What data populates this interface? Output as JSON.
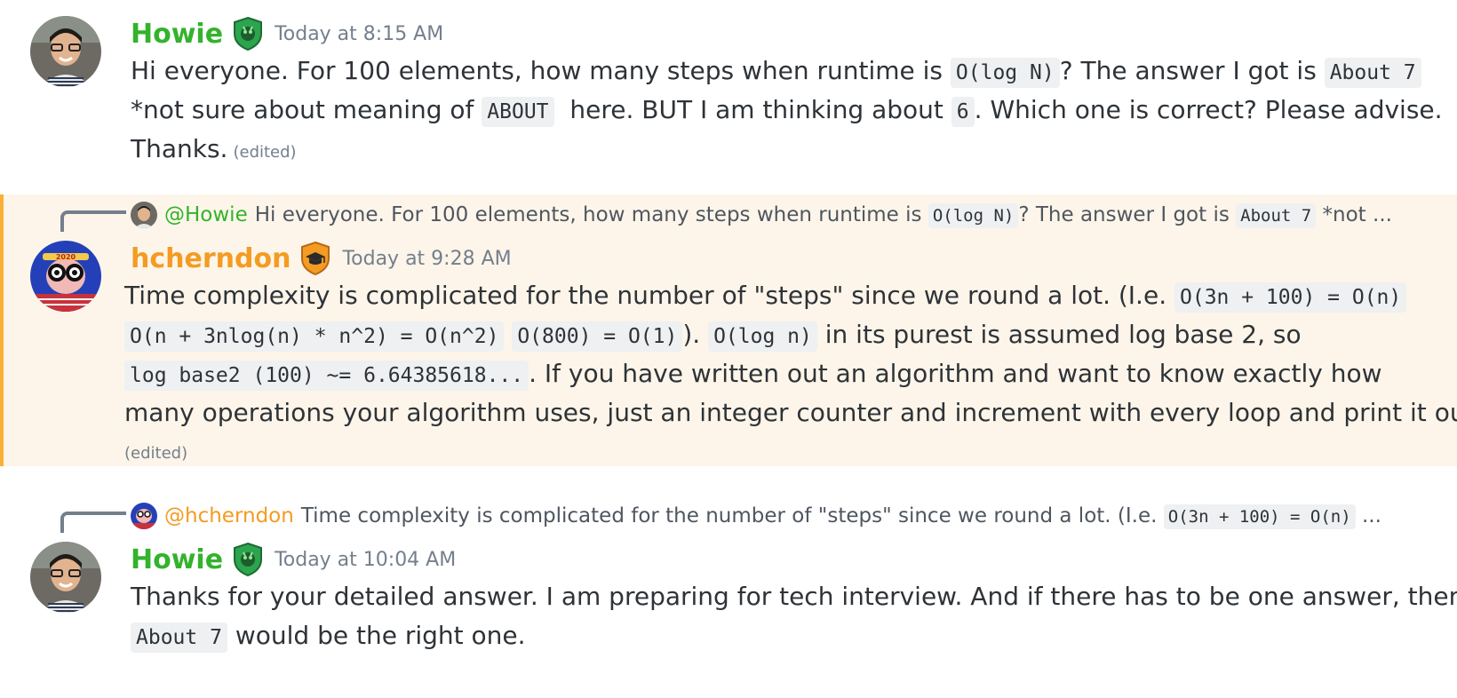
{
  "messages": [
    {
      "author": "Howie",
      "timestamp": "Today at 8:15 AM",
      "line1_a": "Hi everyone. For 100 elements, how many steps when runtime is ",
      "line1_code1": "O(log N)",
      "line1_b": "? The answer I got is ",
      "line1_code2": "About 7",
      "line2_a": "*not sure about meaning of ",
      "line2_code1": "ABOUT",
      "line2_b": "  here. BUT I am thinking about ",
      "line2_code2": "6",
      "line2_c": ". Which one is correct? Please advise.",
      "line3_a": "Thanks.",
      "edited": "(edited)"
    },
    {
      "reply_mention": "@Howie",
      "reply_text_a": "Hi everyone. For 100 elements, how many steps when runtime is ",
      "reply_code1": "O(log N)",
      "reply_text_b": "? The answer I got is ",
      "reply_code2": "About 7",
      "reply_text_c": " *not ...",
      "author": "hcherndon",
      "timestamp": "Today at 9:28 AM",
      "line1_a": "Time complexity is complicated for the number of \"steps\" since we round a lot. (I.e. ",
      "line1_code1": "O(3n + 100) = O(n)",
      "line2_code1": "O(n + 3nlog(n) * n^2) = O(n^2)",
      "line2_code2": "O(800) = O(1)",
      "line2_a": "). ",
      "line2_code3": "O(log n)",
      "line2_b": " in its purest is assumed log base 2, so",
      "line3_code1": "log base2 (100) ~= 6.64385618...",
      "line3_a": ". If you have written out an algorithm and want to know exactly how",
      "line4_a": "many operations your algorithm uses, just an integer counter and increment with every loop and print it out!",
      "edited": "(edited)"
    },
    {
      "reply_mention": "@hcherndon",
      "reply_text_a": "Time complexity is complicated for the number of \"steps\" since we round a lot. (I.e. ",
      "reply_code1": "O(3n + 100) = O(n)",
      "reply_text_b": " ...",
      "author": "Howie",
      "timestamp": "Today at 10:04 AM",
      "line1_a": "Thanks for your detailed answer. I am preparing for tech interview. And if there has to be one answer, then",
      "line2_code1": "About 7",
      "line2_a": " would be the right one."
    }
  ],
  "colors": {
    "howie": "#33b32b",
    "hcherndon": "#f49b22",
    "mention_bg": "#fdf5e9",
    "mention_bar": "#f8b035"
  },
  "icons": {
    "howie_badge": "green-shield-badge-icon",
    "hcherndon_badge": "graduation-cap-badge-icon"
  }
}
